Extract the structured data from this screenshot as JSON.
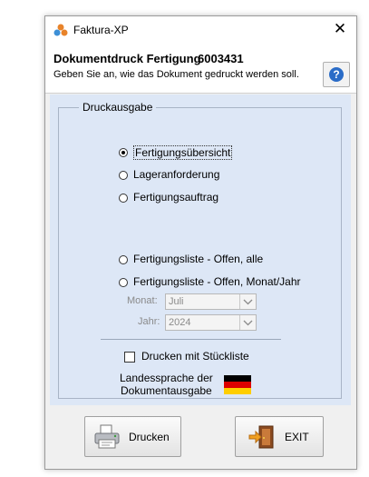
{
  "window": {
    "title": "Faktura-XP",
    "close_glyph": "✕"
  },
  "header": {
    "title": "Dokumentdruck Fertigung",
    "number": "6003431",
    "subtitle": "Geben Sie an, wie das Dokument gedruckt werden soll.",
    "help_glyph": "?"
  },
  "group": {
    "legend": "Druckausgabe",
    "options": [
      {
        "label": "Fertigungsübersicht",
        "selected": true
      },
      {
        "label": "Lageranforderung",
        "selected": false
      },
      {
        "label": "Fertigungsauftrag",
        "selected": false
      },
      {
        "label": "Fertigungsliste - Offen, alle",
        "selected": false
      },
      {
        "label": "Fertigungsliste - Offen, Monat/Jahr",
        "selected": false
      }
    ],
    "month_label": "Monat:",
    "month_value": "Juli",
    "year_label": "Jahr:",
    "year_value": "2024",
    "checkbox_label": "Drucken mit Stückliste",
    "checkbox_checked": false,
    "language_label_line1": "Landessprache der",
    "language_label_line2": "Dokumentausgabe",
    "language_flag": "flag-germany-icon"
  },
  "buttons": {
    "print_label": "Drucken",
    "exit_label": "EXIT"
  },
  "colors": {
    "panel_bg": "#dde7f6",
    "help_blue": "#2a6cc7",
    "flag_black": "#000000",
    "flag_red": "#dd0000",
    "flag_gold": "#ffce00"
  }
}
